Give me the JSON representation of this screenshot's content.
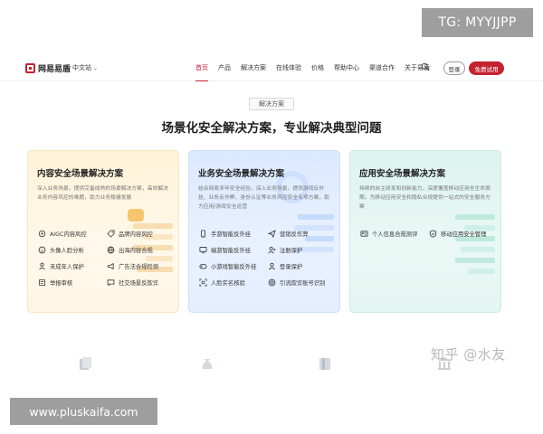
{
  "watermark_top": "TG: MYYJJPP",
  "watermark_bottom": "www.pluskaifa.com",
  "watermark_zhihu": "知乎 @水友",
  "nav": {
    "logo_text": "网易易盾",
    "site_switch": "中文站",
    "menu": [
      "首页",
      "产品",
      "解决方案",
      "在线体验",
      "价格",
      "帮助中心",
      "渠道合作",
      "关于易盾"
    ],
    "active_menu": "首页",
    "login": "登录",
    "trial": "免费试用"
  },
  "section": {
    "badge": "解决方案",
    "headline": "场景化安全解决方案，专业解决典型问题"
  },
  "cards": [
    {
      "title": "内容安全场景解决方案",
      "desc": "深入业务场景，提供完备成熟的场景解决方案，高效解决业务内容风控的难题，助力业务稳健发展",
      "features": [
        "AIGC内容风控",
        "品牌内容风控",
        "头像人脸分析",
        "出海内容合规",
        "未成年人保护",
        "广告法合规检测",
        "举报审核",
        "社交场景反欺诈"
      ]
    },
    {
      "title": "业务安全场景解决方案",
      "desc": "结合网易多年安全经验，深入业务场景，提供游戏反外挂、业务反作弊、身份认证等业务风控安全专项方案，助力应用/游戏安全运营",
      "features": [
        "手游智能反外挂",
        "营销反作弊",
        "端游智能反外挂",
        "注册保护",
        "小游戏智能反外挂",
        "登录保护",
        "人脸实名核验",
        "引流欺诈账号识别"
      ]
    },
    {
      "title": "应用安全场景解决方案",
      "desc": "持续的自主研发和创新能力，深度覆盖移动应用全生命周期，为移动应用安全和隐私合规提供一站式的安全服务方案",
      "features": [
        "个人信息合规测评",
        "移动应用安全管理"
      ]
    }
  ],
  "colors": {
    "brand": "#c42230",
    "card1_bg": "#fff3d8",
    "card2_bg": "#dbe9ff",
    "card3_bg": "#dcf4ee"
  }
}
